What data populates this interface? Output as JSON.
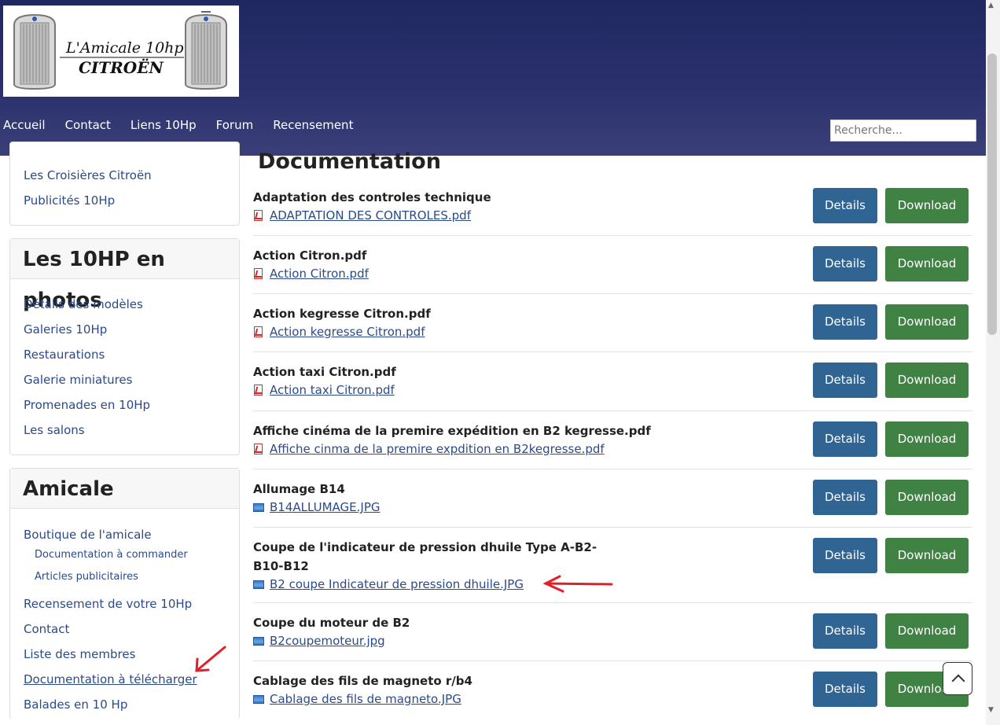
{
  "header": {
    "logo_text_line1": "L'Amicale 10hp",
    "logo_text_line2": "CITROËN",
    "nav": [
      "Accueil",
      "Contact",
      "Liens 10Hp",
      "Forum",
      "Recensement"
    ],
    "search_placeholder": "Recherche..."
  },
  "sidebar": {
    "top_links": [
      "Les Croisières Citroën",
      "Publicités 10Hp"
    ],
    "photos": {
      "title": "Les 10HP en photos",
      "links": [
        "Détails des modèles",
        "Galeries 10Hp",
        "Restaurations",
        "Galerie miniatures",
        "Promenades en 10Hp",
        "Les salons"
      ]
    },
    "amicale": {
      "title": "Amicale",
      "link1": "Boutique de l'amicale",
      "sub1": "Documentation à commander",
      "sub2": "Articles publicitaires",
      "link2": "Recensement de votre 10Hp",
      "link3": "Contact",
      "link4": "Liste des membres",
      "link5": "Documentation à télécharger",
      "link6": "Balades en 10 Hp"
    }
  },
  "main": {
    "heading": "Documentation",
    "details_label": "Details",
    "download_label": "Download",
    "documents": [
      {
        "title": "Adaptation des controles technique",
        "file": "ADAPTATION DES CONTROLES.pdf",
        "type": "pdf"
      },
      {
        "title": "Action Citron.pdf",
        "file": "Action Citron.pdf",
        "type": "pdf"
      },
      {
        "title": "Action kegresse Citron.pdf",
        "file": "Action kegresse Citron.pdf",
        "type": "pdf"
      },
      {
        "title": "Action taxi Citron.pdf",
        "file": "Action taxi Citron.pdf",
        "type": "pdf"
      },
      {
        "title": "Affiche cinéma de la premire expédition en B2 kegresse.pdf",
        "file": "Affiche cinma de la premire expdition en B2kegresse.pdf",
        "type": "pdf"
      },
      {
        "title": "Allumage B14",
        "file": "B14ALLUMAGE.JPG",
        "type": "image"
      },
      {
        "title": "Coupe de l'indicateur de pression dhuile Type A-B2-B10-B12",
        "file": "B2 coupe Indicateur de pression dhuile.JPG",
        "type": "image"
      },
      {
        "title": "Coupe du moteur de B2",
        "file": "B2coupemoteur.jpg",
        "type": "image"
      },
      {
        "title": "Cablage des fils de magneto r/b4",
        "file": "Cablage des fils de magneto.JPG",
        "type": "image"
      }
    ]
  },
  "colors": {
    "header_bg": "#262e69",
    "details_button": "#2f6493",
    "download_button": "#3f8243",
    "link": "#2a4a8a",
    "annotation_arrow": "#e0202a"
  }
}
